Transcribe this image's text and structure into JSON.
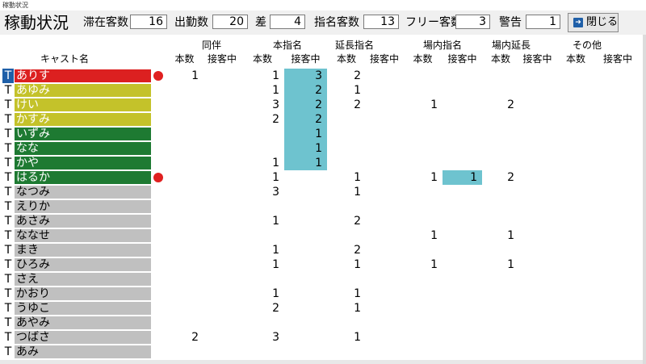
{
  "window": {
    "title": "稼動状況"
  },
  "header": {
    "title": "稼動状況",
    "stats": [
      {
        "label": "滞在客数",
        "value": "16"
      },
      {
        "label": "出勤数",
        "value": "20"
      },
      {
        "label": "差",
        "value": "4"
      },
      {
        "label": "指名客数",
        "value": "13"
      },
      {
        "label": "フリー客数",
        "value": "3"
      },
      {
        "label": "警告",
        "value": "1"
      }
    ],
    "close_label": "閉じる",
    "close_icon": "exit-arrow-icon"
  },
  "table": {
    "name_header": "キャスト名",
    "groups": [
      "同伴",
      "本指名",
      "延長指名",
      "場内指名",
      "場内延長",
      "その他"
    ],
    "sub_headers": [
      "本数",
      "接客中"
    ],
    "colors": {
      "red": "#dc2020",
      "yellow": "#c4c22a",
      "green": "#1e7a32",
      "gray": "#c0c0c0",
      "highlight": "#6ec3cf",
      "dot": "#e02020"
    },
    "rows": [
      {
        "mark": "T",
        "name": "ありす",
        "color": "red",
        "dot": true,
        "cells": [
          "1",
          "",
          "1",
          "3",
          "2",
          "",
          "",
          "",
          "",
          ""
        ],
        "hl": [
          3
        ]
      },
      {
        "mark": "T",
        "name": "あゆみ",
        "color": "yellow",
        "dot": false,
        "cells": [
          "",
          "",
          "1",
          "2",
          "1",
          "",
          "",
          "",
          "",
          ""
        ],
        "hl": [
          3
        ]
      },
      {
        "mark": "T",
        "name": "けい",
        "color": "yellow",
        "dot": false,
        "cells": [
          "",
          "",
          "3",
          "2",
          "2",
          "",
          "1",
          "",
          "2",
          ""
        ],
        "hl": [
          3
        ]
      },
      {
        "mark": "T",
        "name": "かすみ",
        "color": "yellow",
        "dot": false,
        "cells": [
          "",
          "",
          "2",
          "2",
          "",
          "",
          "",
          "",
          "",
          ""
        ],
        "hl": [
          3
        ]
      },
      {
        "mark": "T",
        "name": "いずみ",
        "color": "green",
        "dot": false,
        "cells": [
          "",
          "",
          "",
          "1",
          "",
          "",
          "",
          "",
          "",
          ""
        ],
        "hl": [
          3
        ]
      },
      {
        "mark": "T",
        "name": "なな",
        "color": "green",
        "dot": false,
        "cells": [
          "",
          "",
          "",
          "1",
          "",
          "",
          "",
          "",
          "",
          ""
        ],
        "hl": [
          3
        ]
      },
      {
        "mark": "T",
        "name": "かや",
        "color": "green",
        "dot": false,
        "cells": [
          "",
          "",
          "1",
          "1",
          "",
          "",
          "",
          "",
          "",
          ""
        ],
        "hl": [
          3
        ]
      },
      {
        "mark": "T",
        "name": "はるか",
        "color": "green",
        "dot": true,
        "cells": [
          "",
          "",
          "1",
          "",
          "1",
          "",
          "1",
          "1",
          "2",
          ""
        ],
        "hl": [
          7
        ]
      },
      {
        "mark": "T",
        "name": "なつみ",
        "color": "gray",
        "dot": false,
        "cells": [
          "",
          "",
          "3",
          "",
          "1",
          "",
          "",
          "",
          "",
          ""
        ],
        "hl": []
      },
      {
        "mark": "T",
        "name": "えりか",
        "color": "gray",
        "dot": false,
        "cells": [
          "",
          "",
          "",
          "",
          "",
          "",
          "",
          "",
          "",
          ""
        ],
        "hl": []
      },
      {
        "mark": "T",
        "name": "あさみ",
        "color": "gray",
        "dot": false,
        "cells": [
          "",
          "",
          "1",
          "",
          "2",
          "",
          "",
          "",
          "",
          ""
        ],
        "hl": []
      },
      {
        "mark": "T",
        "name": "ななせ",
        "color": "gray",
        "dot": false,
        "cells": [
          "",
          "",
          "",
          "",
          "",
          "",
          "1",
          "",
          "1",
          ""
        ],
        "hl": []
      },
      {
        "mark": "T",
        "name": "まき",
        "color": "gray",
        "dot": false,
        "cells": [
          "",
          "",
          "1",
          "",
          "2",
          "",
          "",
          "",
          "",
          ""
        ],
        "hl": []
      },
      {
        "mark": "T",
        "name": "ひろみ",
        "color": "gray",
        "dot": false,
        "cells": [
          "",
          "",
          "1",
          "",
          "1",
          "",
          "1",
          "",
          "1",
          ""
        ],
        "hl": []
      },
      {
        "mark": "T",
        "name": "さえ",
        "color": "gray",
        "dot": false,
        "cells": [
          "",
          "",
          "",
          "",
          "",
          "",
          "",
          "",
          "",
          ""
        ],
        "hl": []
      },
      {
        "mark": "T",
        "name": "かおり",
        "color": "gray",
        "dot": false,
        "cells": [
          "",
          "",
          "1",
          "",
          "1",
          "",
          "",
          "",
          "",
          ""
        ],
        "hl": []
      },
      {
        "mark": "T",
        "name": "うゆこ",
        "color": "gray",
        "dot": false,
        "cells": [
          "",
          "",
          "2",
          "",
          "1",
          "",
          "",
          "",
          "",
          ""
        ],
        "hl": []
      },
      {
        "mark": "T",
        "name": "あやみ",
        "color": "gray",
        "dot": false,
        "cells": [
          "",
          "",
          "",
          "",
          "",
          "",
          "",
          "",
          "",
          ""
        ],
        "hl": []
      },
      {
        "mark": "T",
        "name": "つばさ",
        "color": "gray",
        "dot": false,
        "cells": [
          "2",
          "",
          "3",
          "",
          "1",
          "",
          "",
          "",
          "",
          ""
        ],
        "hl": []
      },
      {
        "mark": "T",
        "name": "あみ",
        "color": "gray",
        "dot": false,
        "cells": [
          "",
          "",
          "",
          "",
          "",
          "",
          "",
          "",
          "",
          ""
        ],
        "hl": []
      }
    ]
  }
}
